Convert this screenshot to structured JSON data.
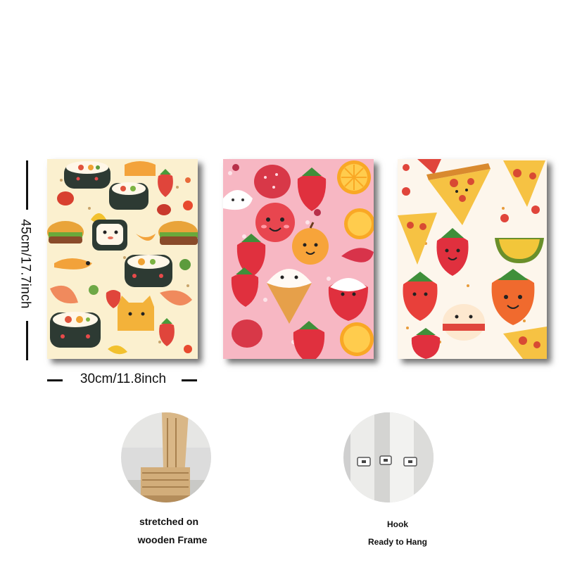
{
  "dimensions": {
    "height_label": "45cm/17.7inch",
    "width_label": "30cm/11.8inch"
  },
  "panels": [
    {
      "theme": "sushi",
      "background": "#fbf0cf"
    },
    {
      "theme": "fruit",
      "background": "#f7b7c3"
    },
    {
      "theme": "pizza",
      "background": "#fdf6ec"
    }
  ],
  "features": {
    "frame": {
      "line1": "stretched on",
      "line2": "wooden Frame"
    },
    "hook": {
      "line1": "Hook",
      "line2": "Ready to Hang"
    }
  }
}
